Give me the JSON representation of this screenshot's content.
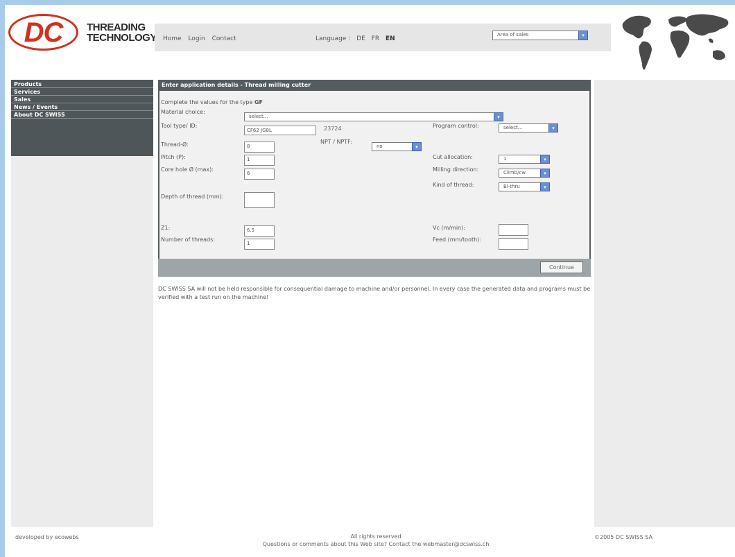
{
  "logo": {
    "mark": "DC",
    "line1": "THREADING",
    "line2": "TECHNOLOGY"
  },
  "nav": {
    "home": "Home",
    "login": "Login",
    "contact": "Contact"
  },
  "language": {
    "label": "Language :",
    "de": "DE",
    "fr": "FR",
    "en": "EN",
    "active": "EN"
  },
  "area_select": {
    "value": "Area of sales"
  },
  "sidebar": {
    "items": [
      "Products",
      "Services",
      "Sales",
      "News / Events",
      "About DC SWISS"
    ]
  },
  "form": {
    "title": "Enter application details - Thread milling cutter",
    "intro": "Complete the values for the type",
    "type_code": "GF",
    "material_label": "Material choice:",
    "material_value": "select...",
    "tool_type_label": "Tool type/ ID:",
    "tool_type_value": "CF62 JG8L",
    "tool_id_value": "23724",
    "program_control_label": "Program control:",
    "program_control_value": "select...",
    "thread_label": "Thread-Ø:",
    "thread_value": "8",
    "npt_label": "NPT / NPTF:",
    "npt_value": "no",
    "pitch_label": "Pitch (P):",
    "pitch_value": "1",
    "cut_allocation_label": "Cut allocation:",
    "cut_allocation_value": "1",
    "core_hole_label": "Core hole Ø (max):",
    "core_hole_value": "6",
    "milling_direction_label": "Milling direction:",
    "milling_direction_value": "Climb/cw",
    "kind_of_thread_label": "Kind of thread:",
    "kind_of_thread_value": "Bl-thru",
    "depth_label": "Depth of thread (mm):",
    "depth_value": "",
    "z_label": "Z1:",
    "z_value": "6.5",
    "number_threads_label": "Number of threads:",
    "number_threads_value": "1",
    "vc_label": "Vc (m/min):",
    "vc_value": "",
    "feed_label": "Feed (mm/tooth):",
    "feed_value": "",
    "continue_label": "Continue"
  },
  "disclaimer": "DC SWISS SA will not be held responsible for consequential damage to machine and/or personnel. In every case the generated data and programs must be verified with a test run on the machine!",
  "footer": {
    "developed_by": "developed by ecowebs",
    "rights": "All rights reserved",
    "contact_line": "Questions or comments about this Web site? Contact the webmaster@dcswiss.ch",
    "copyright": "©2005 DC SWISS SA"
  },
  "colors": {
    "background": "#a8cbea",
    "brand_red": "#d1311d",
    "panel_dark": "#555c5f",
    "select_arrow": "#6c8fd0"
  }
}
